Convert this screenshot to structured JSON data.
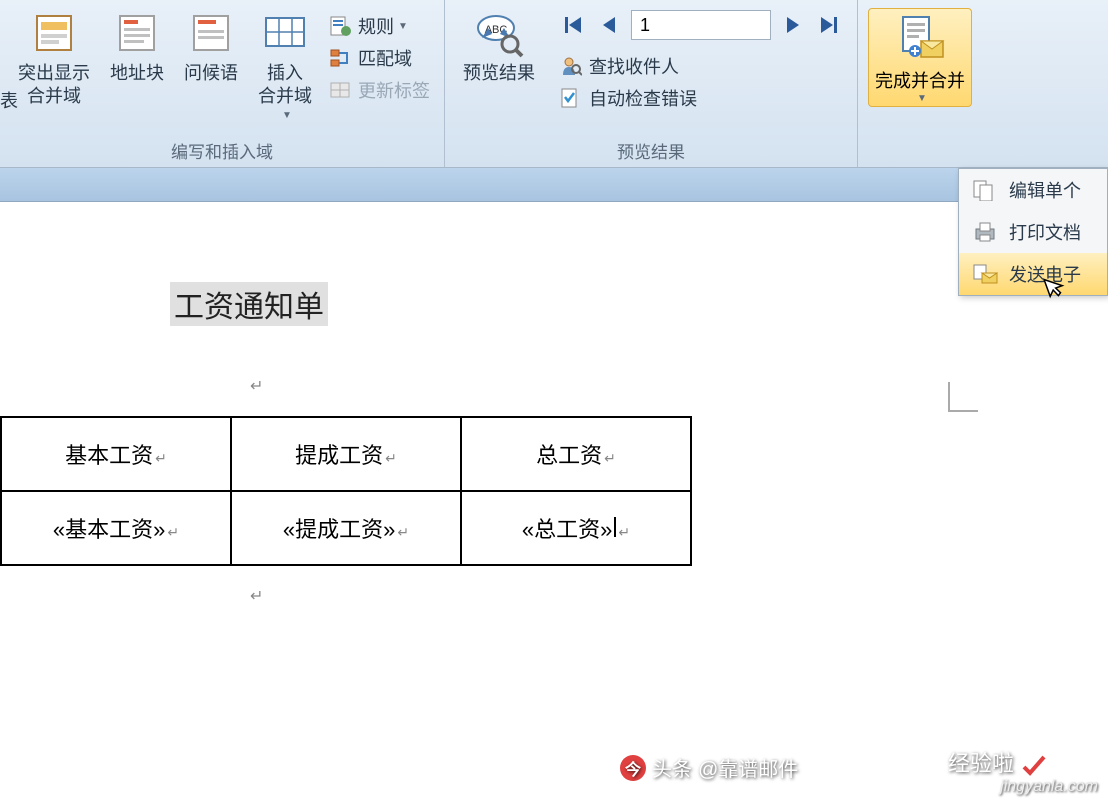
{
  "ribbon": {
    "group1": {
      "items": [
        {
          "label": "突出显示\n合并域"
        },
        {
          "label": "地址块"
        },
        {
          "label": "问候语"
        },
        {
          "label": "插入\n合并域"
        }
      ],
      "side_items": [
        {
          "label": "规则",
          "enabled": true
        },
        {
          "label": "匹配域",
          "enabled": true
        },
        {
          "label": "更新标签",
          "enabled": false
        }
      ],
      "label": "编写和插入域"
    },
    "group2": {
      "preview_label": "预览结果",
      "record_value": "1",
      "side_items": [
        {
          "label": "查找收件人"
        },
        {
          "label": "自动检查错误"
        }
      ],
      "label": "预览结果"
    },
    "group3": {
      "finish_label": "完成并合并"
    },
    "partial_left": "表"
  },
  "dropdown": {
    "items": [
      {
        "label": "编辑单个",
        "icon": "edit-docs"
      },
      {
        "label": "打印文档",
        "icon": "print"
      },
      {
        "label": "发送电子",
        "icon": "email",
        "highlighted": true
      }
    ]
  },
  "document": {
    "title": "工资通知单",
    "table": {
      "headers": [
        "基本工资",
        "提成工资",
        "总工资"
      ],
      "fields": [
        "«基本工资»",
        "«提成工资»",
        "«总工资»"
      ]
    }
  },
  "watermarks": {
    "toutiao_prefix": "头条",
    "toutiao_user": "@靠谱邮件",
    "jingyan": "经验啦",
    "url": "jingyanla.com"
  }
}
